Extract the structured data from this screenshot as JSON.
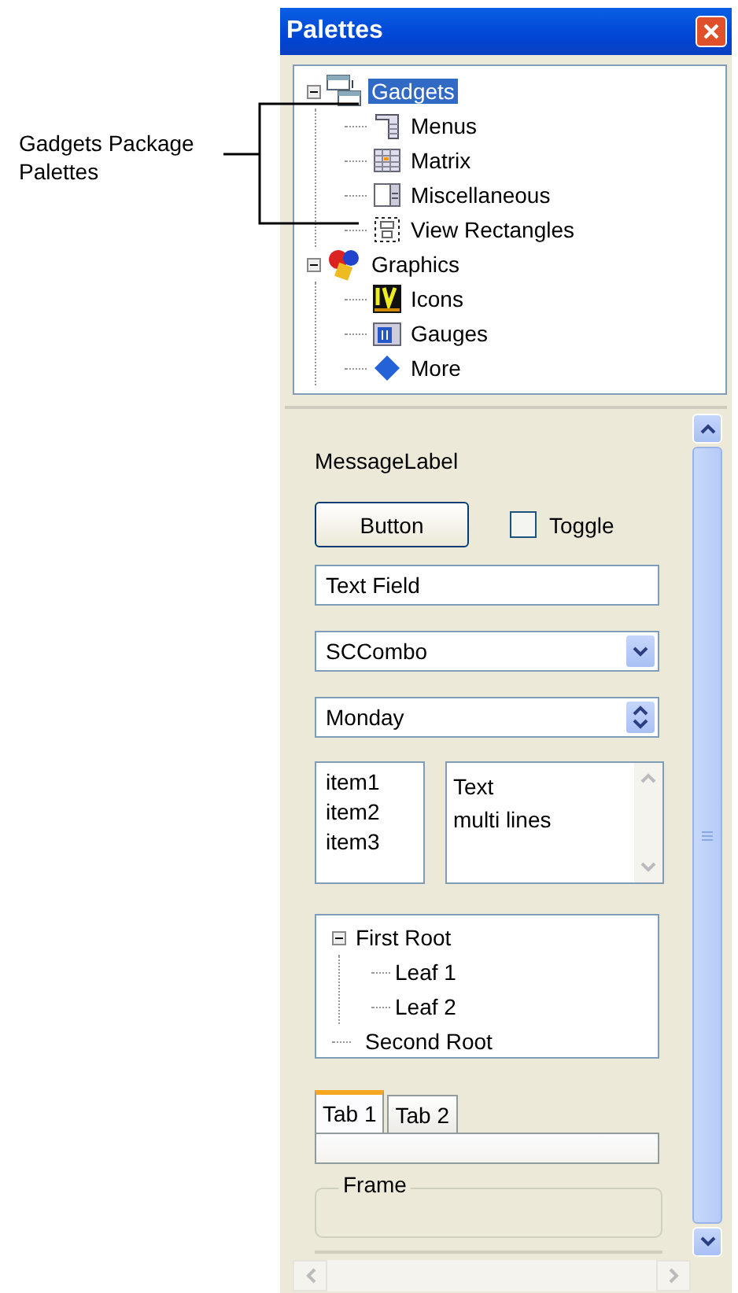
{
  "callout": {
    "text": "Gadgets Package Palettes"
  },
  "window": {
    "title": "Palettes"
  },
  "palette_tree": [
    {
      "label": "Gadgets",
      "kind": "gadgets",
      "selected": true,
      "expanded": true,
      "children": [
        {
          "label": "Menus",
          "kind": "menus",
          "selected": false
        },
        {
          "label": "Matrix",
          "kind": "matrix",
          "selected": false
        },
        {
          "label": "Miscellaneous",
          "kind": "misc",
          "selected": false
        },
        {
          "label": "View Rectangles",
          "kind": "viewrect",
          "selected": false
        }
      ]
    },
    {
      "label": "Graphics",
      "kind": "graphics",
      "selected": false,
      "expanded": true,
      "children": [
        {
          "label": "Icons",
          "kind": "icons",
          "selected": false
        },
        {
          "label": "Gauges",
          "kind": "gauges",
          "selected": false
        },
        {
          "label": "More",
          "kind": "more",
          "selected": false
        }
      ]
    }
  ],
  "preview": {
    "message_label": "MessageLabel",
    "button": "Button",
    "toggle": {
      "label": "Toggle",
      "checked": false
    },
    "text_field": {
      "value": "Text Field"
    },
    "combo": {
      "value": "SCCombo"
    },
    "spinner": {
      "value": "Monday"
    },
    "list": [
      "item1",
      "item2",
      "item3"
    ],
    "text_area": {
      "value": "Text\nmulti lines"
    },
    "tree": [
      {
        "label": "First Root",
        "expanded": true,
        "children": [
          {
            "label": "Leaf 1"
          },
          {
            "label": "Leaf 2"
          }
        ]
      },
      {
        "label": "Second Root"
      }
    ],
    "tabs": [
      {
        "label": "Tab 1",
        "selected": true
      },
      {
        "label": "Tab 2",
        "selected": false
      }
    ],
    "frame": {
      "label": "Frame"
    }
  }
}
